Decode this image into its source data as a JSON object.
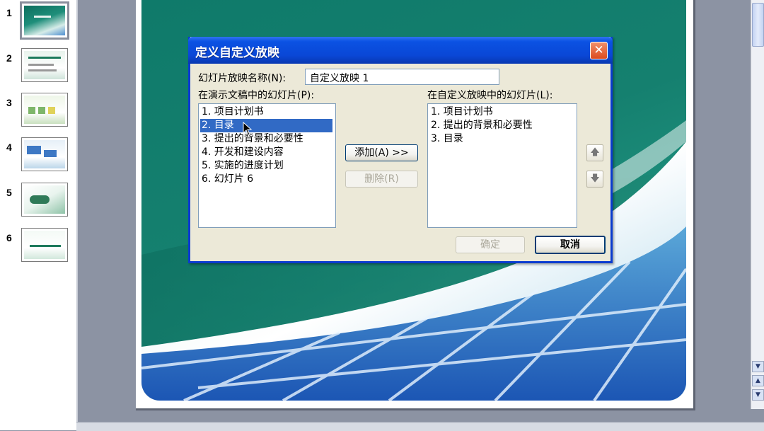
{
  "thumbnails": [
    {
      "number": "1",
      "selected": true
    },
    {
      "number": "2",
      "selected": false
    },
    {
      "number": "3",
      "selected": false
    },
    {
      "number": "4",
      "selected": false
    },
    {
      "number": "5",
      "selected": false
    },
    {
      "number": "6",
      "selected": false
    }
  ],
  "dialog": {
    "title": "定义自定义放映",
    "close_glyph": "✕",
    "name_label": "幻灯片放映名称(N):",
    "name_value": "自定义放映 1",
    "left_list_label": "在演示文稿中的幻灯片(P):",
    "right_list_label": "在自定义放映中的幻灯片(L):",
    "left_items": [
      "1. 项目计划书",
      "2. 目录",
      "3. 提出的背景和必要性",
      "4. 开发和建设内容",
      "5. 实施的进度计划",
      "6. 幻灯片 6"
    ],
    "left_selected_index": 1,
    "right_items": [
      "1. 项目计划书",
      "2. 提出的背景和必要性",
      "3. 目录"
    ],
    "add_button": "添加(A) >>",
    "remove_button": "删除(R)",
    "ok_button": "确定",
    "cancel_button": "取消",
    "move_up_glyph": "🡅",
    "move_down_glyph": "🡇"
  },
  "colors": {
    "titlebar": "#0a47d6",
    "selection": "#316ac5",
    "slide_green": "#15806f",
    "dialog_bg": "#ece9d8"
  }
}
